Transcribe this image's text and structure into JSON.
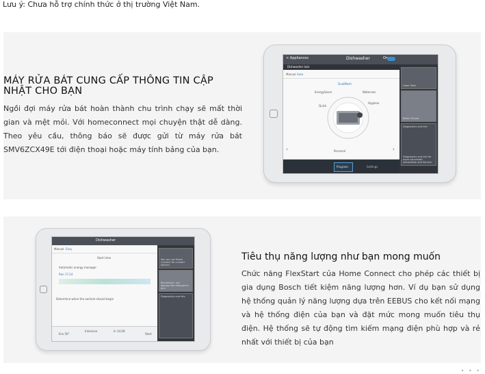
{
  "note": "Lưu ý: Chưa hỗ trợ chính thức ở thị trường Việt Nam.",
  "section1": {
    "title": "MÁY RỬA BÁT CUNG CẤP THÔNG TIN CẬP NHẬT CHO BẠN",
    "body": "Ngồi đợi máy rửa bát hoàn thành chu trình chạy sẽ mất thời gian và mệt mỏi. Với homeconnect mọi chuyện thật dễ dàng. Theo yêu cầu, thông báo sẽ được gửi từ máy rửa bát SMV6ZCX49E tới điện thoại hoặc máy tính bảng của bạn.",
    "screen": {
      "back": "< Appliances",
      "title": "Dishwasher",
      "on": "On",
      "item": "Dishwasher lock",
      "tab_manual": "Manual",
      "tab_auto": "Auto",
      "program_a": "EnergySaver",
      "program_b": "Quick",
      "program_c": "DualWash",
      "program_d": "Watercalc",
      "program_e": "Hygiene",
      "bottom": "Personal",
      "side_1": "Laser flash",
      "side_2": "Bottle Rinsed",
      "side_3": "Diagnostics and info",
      "side_3b": "Diagnostics and info for more connected information and Service",
      "btn1": "Program",
      "btn2": "Settings"
    }
  },
  "section2": {
    "title": "Tiêu thụ năng lượng như bạn mong muốn",
    "body": "Chức năng FlexStart của Home Connect cho phép các thiết bị gia dụng Bosch tiết kiệm năng lượng hơn. Ví dụ bạn sử dụng hệ thống quản lý năng lượng dựa trên EEBUS cho kết nối mạng và hệ thống điện của bạn và đặt mức mong muốn tiêu thụ điện. Hệ thống sẽ tự động tìm kiếm mạng điện phù hợp và rẻ nhất với thiết bị của bạn",
    "screen": {
      "title": "Dishwasher",
      "tab_manual": "Manual",
      "tab_easy": "Easy",
      "label_flex": "Start time",
      "label_auto": "Automatic energy manager",
      "time": "Ren 17:24",
      "footer_note": "Determine when the earliest should begin",
      "bottom_1": "Eco 50°",
      "bottom_2": "Intensive",
      "bottom_3": "In 14:28",
      "bottom_4": "Start",
      "side_1": "You can use Home Connect for a smart kitchen",
      "side_2": "Remember: use appropriate detergents and",
      "side_3": "Diagnostics and info"
    }
  }
}
